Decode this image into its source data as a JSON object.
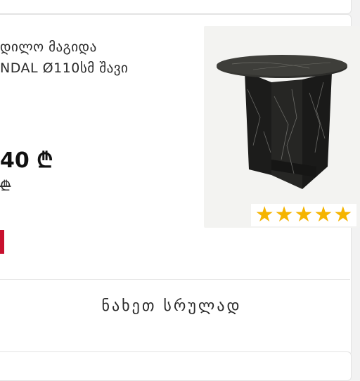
{
  "product": {
    "title": "დილო მაგიდა\nNDAL Ø110სმ შავი",
    "price": "40 ₾",
    "old_price": "₾",
    "rating_stars": 5,
    "image_icon": "round-table-image"
  },
  "actions": {
    "view_full_label": "ნახეთ სრულად"
  },
  "colors": {
    "sale_badge": "#c8102e",
    "star": "#f5b400"
  }
}
